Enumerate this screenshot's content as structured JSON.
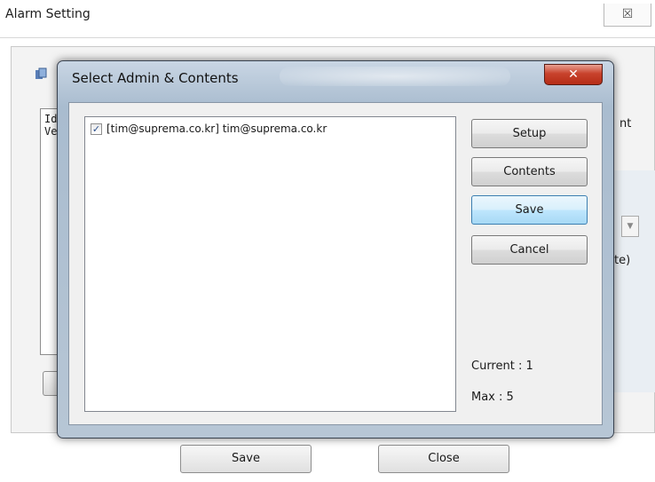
{
  "background_window": {
    "title": "Alarm Setting",
    "close_glyph": "☒",
    "listbox_lines": [
      "Id",
      "Ve"
    ],
    "right_fragment_top": "nt",
    "right_fragment_mid": "te)",
    "save_label": "Save",
    "close_label": "Close"
  },
  "dialog": {
    "title": "Select Admin & Contents",
    "close_glyph": "✕",
    "admins": [
      {
        "checked": true,
        "check_glyph": "✓",
        "label": "[tim@suprema.co.kr] tim@suprema.co.kr"
      }
    ],
    "buttons": {
      "setup": "Setup",
      "contents": "Contents",
      "save": "Save",
      "cancel": "Cancel"
    },
    "current": "Current : 1",
    "max": "Max : 5"
  },
  "colors": {
    "dialog_frame": "#b7c6d5",
    "close_red": "#c8422c",
    "focus_blue": "#3c7fb1"
  },
  "icons": {
    "dialog_close": "close-icon",
    "checkbox": "checkmark-icon",
    "bg_icon": "app-icon"
  }
}
